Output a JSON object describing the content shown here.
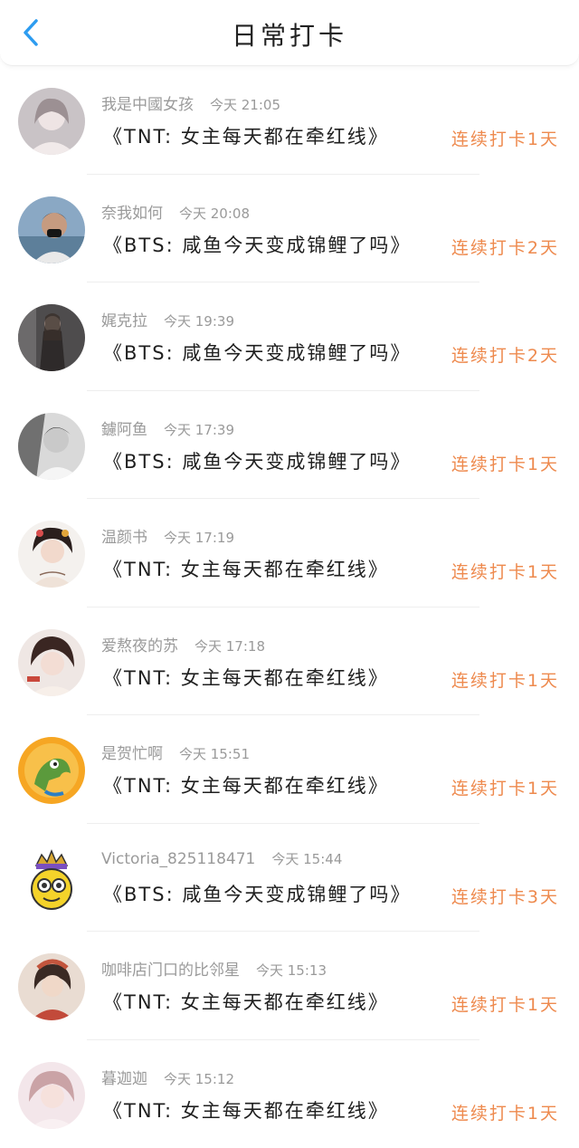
{
  "header": {
    "title": "日常打卡"
  },
  "entries": [
    {
      "user": "我是中國女孩",
      "time": "今天 21:05",
      "content": "《TNT: 女主每天都在牵红线》",
      "streak": "连续打卡1天"
    },
    {
      "user": "奈我如何",
      "time": "今天 20:08",
      "content": "《BTS: 咸鱼今天变成锦鲤了吗》",
      "streak": "连续打卡2天"
    },
    {
      "user": "娓克拉",
      "time": "今天 19:39",
      "content": "《BTS: 咸鱼今天变成锦鲤了吗》",
      "streak": "连续打卡2天"
    },
    {
      "user": "鑢阿鱼",
      "time": "今天 17:39",
      "content": "《BTS: 咸鱼今天变成锦鲤了吗》",
      "streak": "连续打卡1天"
    },
    {
      "user": "温颜书",
      "time": "今天 17:19",
      "content": "《TNT: 女主每天都在牵红线》",
      "streak": "连续打卡1天"
    },
    {
      "user": "爱熬夜的苏",
      "time": "今天 17:18",
      "content": "《TNT: 女主每天都在牵红线》",
      "streak": "连续打卡1天"
    },
    {
      "user": "是贺忙啊",
      "time": "今天 15:51",
      "content": "《TNT: 女主每天都在牵红线》",
      "streak": "连续打卡1天"
    },
    {
      "user": "Victoria_825118471",
      "time": "今天 15:44",
      "content": "《BTS: 咸鱼今天变成锦鲤了吗》",
      "streak": "连续打卡3天"
    },
    {
      "user": "咖啡店门口的比邻星",
      "time": "今天 15:13",
      "content": "《TNT: 女主每天都在牵红线》",
      "streak": "连续打卡1天"
    },
    {
      "user": "暮迦迦",
      "time": "今天 15:12",
      "content": "《TNT: 女主每天都在牵红线》",
      "streak": "连续打卡1天"
    }
  ],
  "colors": {
    "accent_back": "#2d9cf0",
    "streak": "#ee8a4e"
  },
  "icons": {
    "back": "chevron-left-icon"
  }
}
